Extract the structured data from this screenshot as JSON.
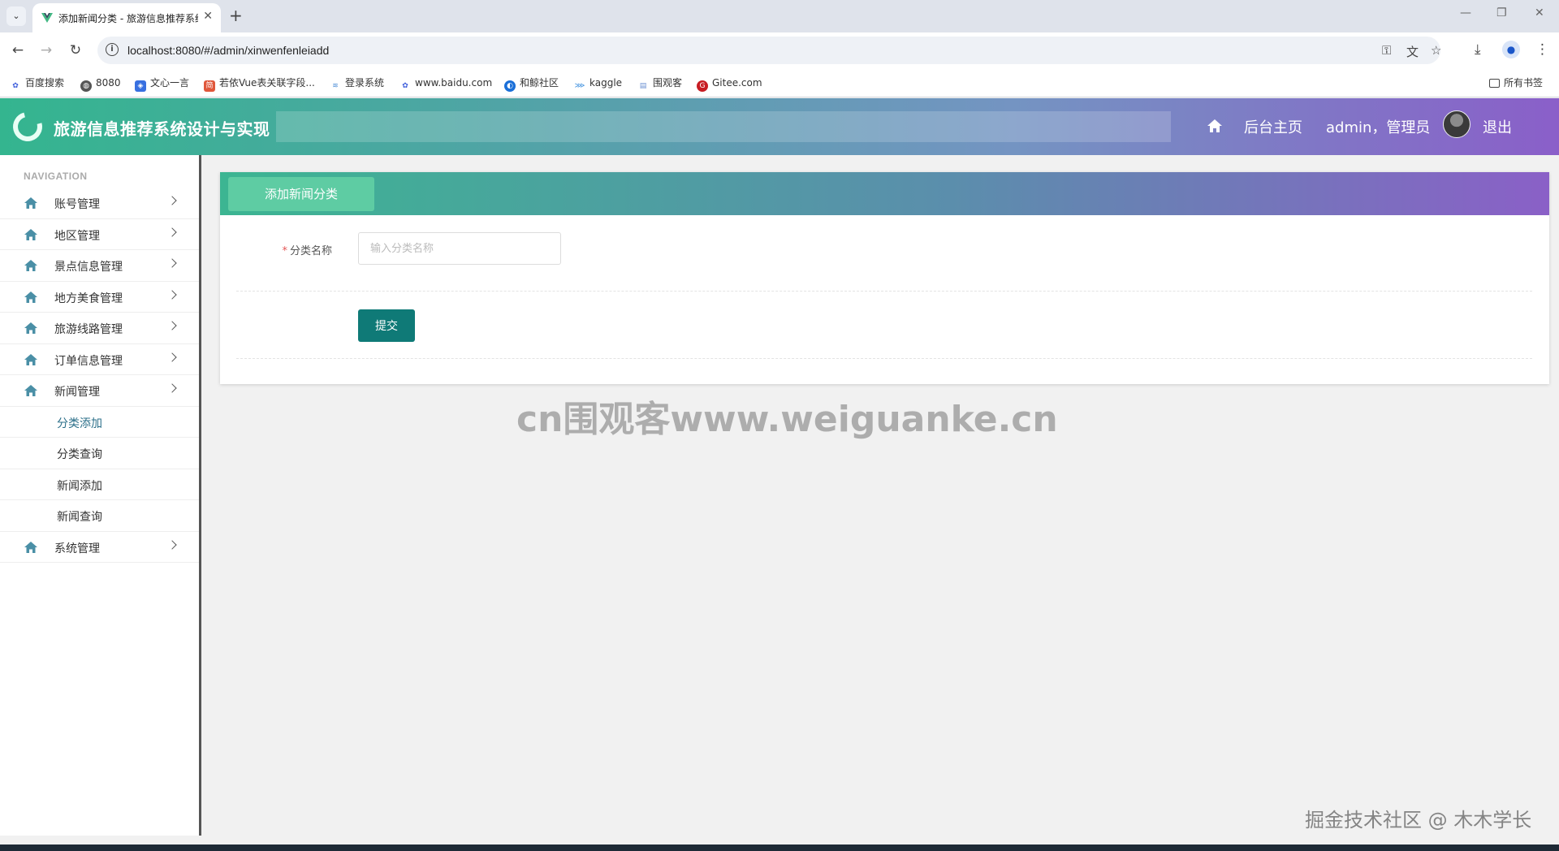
{
  "browser": {
    "tab_title": "添加新闻分类 - 旅游信息推荐系统",
    "url": "localhost:8080/#/admin/xinwenfenleiadd",
    "bookmarks": [
      {
        "label": "百度搜索",
        "color": "#3b5bdb"
      },
      {
        "label": "8080",
        "color": "#555555"
      },
      {
        "label": "文心一言",
        "color": "#3870e0"
      },
      {
        "label": "若依Vue表关联字段...",
        "color": "#e0573b"
      },
      {
        "label": "登录系统",
        "color": "#4c8dd6"
      },
      {
        "label": "www.baidu.com",
        "color": "#3b5bdb"
      },
      {
        "label": "和鲸社区",
        "color": "#1b6fd8"
      },
      {
        "label": "kaggle",
        "color": "#3b8ede"
      },
      {
        "label": "围观客",
        "color": "#6a8fd1"
      },
      {
        "label": "Gitee.com",
        "color": "#c71d23"
      }
    ],
    "all_bookmarks_label": "所有书签"
  },
  "header": {
    "title": "旅游信息推荐系统设计与实现",
    "home_link": "后台主页",
    "user": "admin，管理员",
    "logout": "退出"
  },
  "sidebar": {
    "caption": "NAVIGATION",
    "items": [
      {
        "label": "账号管理"
      },
      {
        "label": "地区管理"
      },
      {
        "label": "景点信息管理"
      },
      {
        "label": "地方美食管理"
      },
      {
        "label": "旅游线路管理"
      },
      {
        "label": "订单信息管理"
      },
      {
        "label": "新闻管理"
      },
      {
        "label": "系统管理"
      }
    ],
    "sub_items": [
      {
        "label": "分类添加",
        "active": true
      },
      {
        "label": "分类查询"
      },
      {
        "label": "新闻添加"
      },
      {
        "label": "新闻查询"
      }
    ]
  },
  "panel": {
    "title": "添加新闻分类",
    "field_required_mark": "*",
    "field_label": "分类名称",
    "field_placeholder": "输入分类名称",
    "field_value": "",
    "submit_label": "提交"
  },
  "watermarks": {
    "center": "cn围观客www.weiguanke.cn",
    "corner": "掘金技术社区 @ 木木学长"
  },
  "colors": {
    "accent": "#0f7a77",
    "header_start": "#34b58f",
    "header_end": "#8a5fc9"
  }
}
